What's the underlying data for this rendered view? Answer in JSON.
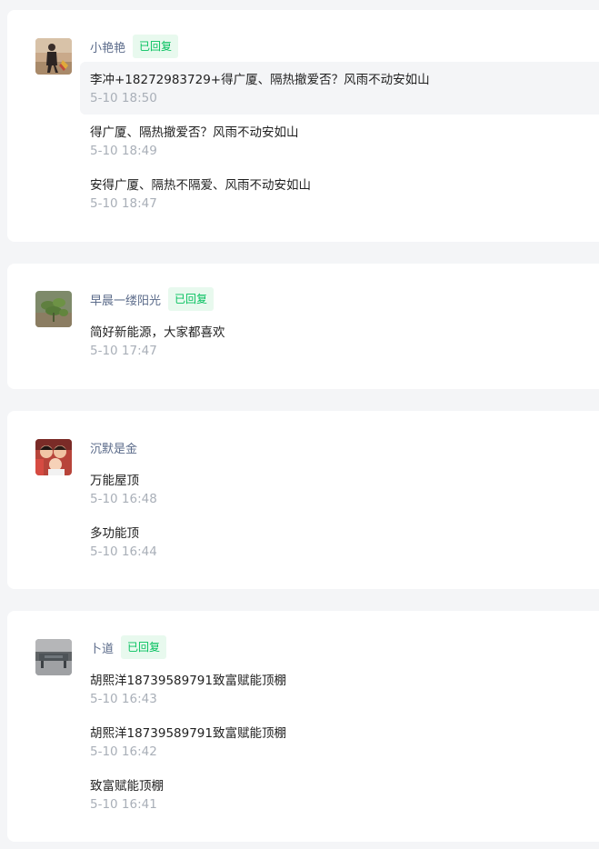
{
  "threads": [
    {
      "nickname": "小艳艳",
      "badge": "已回复",
      "avatar_icon": "avatar-person-outdoor",
      "messages": [
        {
          "text": "李冲+18272983729+得广厦、隔热撤爱否？风雨不动安如山",
          "time": "5-10 18:50"
        },
        {
          "text": "得广厦、隔热撤爱否？风雨不动安如山",
          "time": "5-10 18:49"
        },
        {
          "text": "安得广厦、隔热不隔爱、风雨不动安如山",
          "time": "5-10 18:47"
        }
      ]
    },
    {
      "nickname": "早晨一缕阳光",
      "badge": "已回复",
      "avatar_icon": "avatar-plant",
      "messages": [
        {
          "text": "简好新能源，大家都喜欢",
          "time": "5-10 17:47"
        }
      ]
    },
    {
      "nickname": "沉默是金",
      "badge": "",
      "avatar_icon": "avatar-family-photo",
      "messages": [
        {
          "text": "万能屋顶",
          "time": "5-10 16:48"
        },
        {
          "text": "多功能顶",
          "time": "5-10 16:44"
        }
      ]
    },
    {
      "nickname": "卜道",
      "badge": "已回复",
      "avatar_icon": "avatar-landscape",
      "messages": [
        {
          "text": "胡熙洋18739589791致富赋能顶棚",
          "time": "5-10 16:43"
        },
        {
          "text": "胡熙洋18739589791致富赋能顶棚",
          "time": "5-10 16:42"
        },
        {
          "text": "致富赋能顶棚",
          "time": "5-10 16:41"
        }
      ]
    }
  ],
  "colors": {
    "page_bg": "#f4f5f7",
    "card_bg": "#ffffff",
    "nickname": "#5b6b8a",
    "badge_text": "#07c160",
    "badge_bg": "#e8f9ee",
    "message_text": "#1f1f1f",
    "time_text": "#a9afb8"
  }
}
